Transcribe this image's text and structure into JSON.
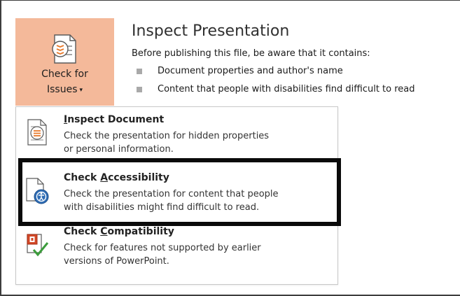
{
  "button": {
    "label_line1": "Check for",
    "label_line2": "Issues",
    "caret": "▾"
  },
  "panel": {
    "title": "Inspect Presentation",
    "subtitle": "Before publishing this file, be aware that it contains:",
    "bullets": [
      "Document properties and author's name",
      "Content that people with disabilities find difficult to read"
    ]
  },
  "menu": {
    "items": [
      {
        "title_pre": "",
        "title_u": "I",
        "title_post": "nspect Document",
        "desc_line1": "Check the presentation for hidden properties",
        "desc_line2": "or personal information.",
        "icon": "inspect-document-icon"
      },
      {
        "title_pre": "Check ",
        "title_u": "A",
        "title_post": "ccessibility",
        "desc_line1": "Check the presentation for content that people",
        "desc_line2": "with disabilities might find difficult to read.",
        "icon": "accessibility-icon"
      },
      {
        "title_pre": "Check ",
        "title_u": "C",
        "title_post": "ompatibility",
        "desc_line1": "Check for features not supported by earlier",
        "desc_line2": "versions of PowerPoint.",
        "icon": "compatibility-icon"
      }
    ]
  },
  "colors": {
    "button_bg": "#f4b99a",
    "highlight_border": "#0a0a0a",
    "accent_orange": "#e8792a",
    "accent_blue": "#2f6db5",
    "check_green": "#3c9c3c"
  }
}
